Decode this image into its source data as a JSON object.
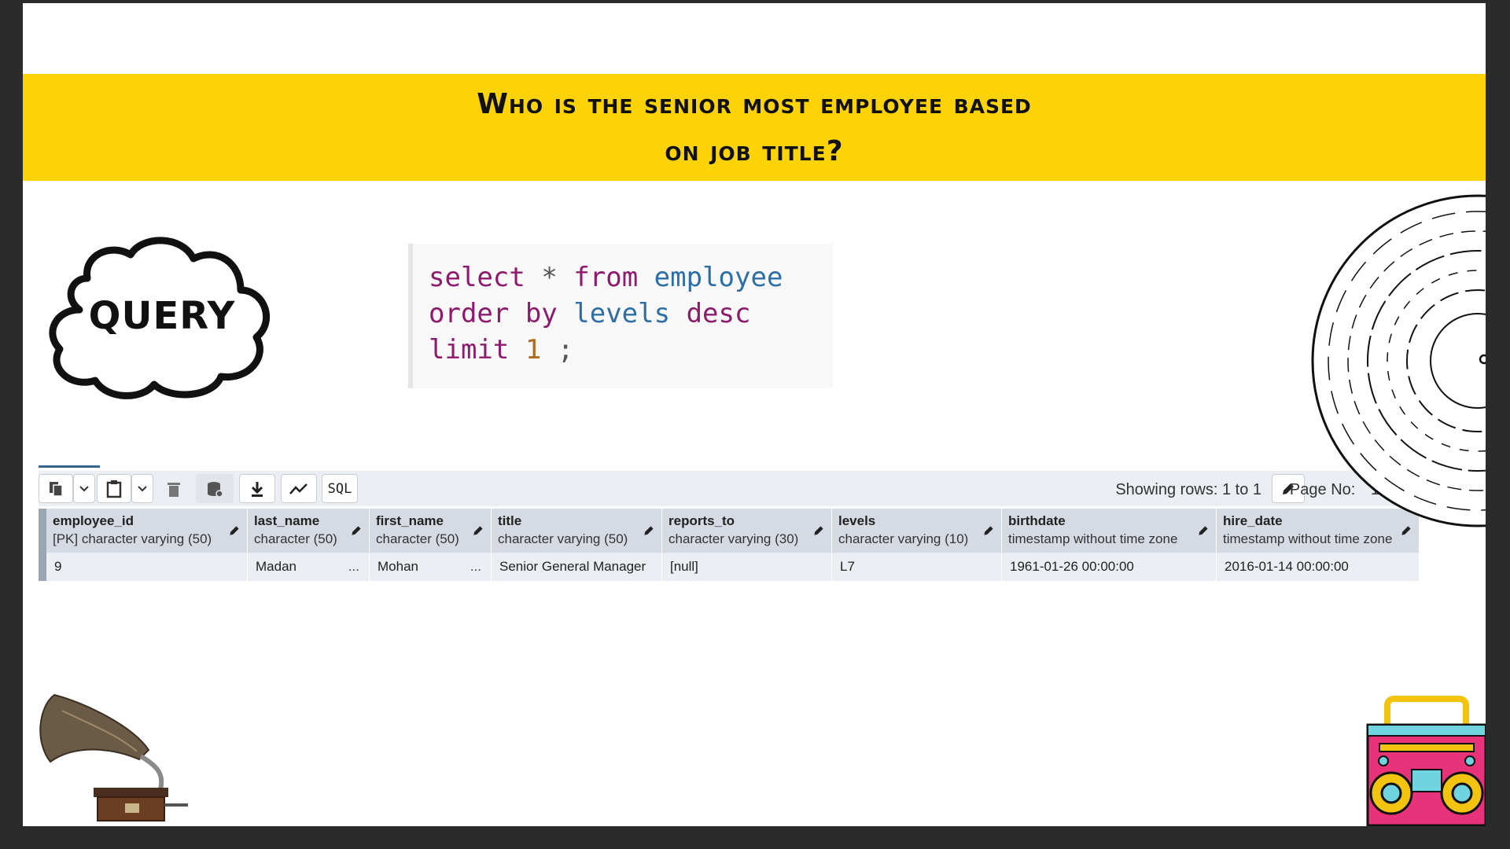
{
  "banner": {
    "line1": "Who is the senior most employee based",
    "line2": "on job title?"
  },
  "cloud_label": "QUERY",
  "code": {
    "line1": [
      "select",
      "*",
      "from",
      "employee"
    ],
    "line2": [
      "order by",
      "levels",
      "desc"
    ],
    "line3": [
      "limit",
      "1",
      ";"
    ]
  },
  "toolbar": {
    "sql_label": "SQL",
    "showing_rows": "Showing rows: 1 to 1",
    "page_no_label": "Page No:",
    "page_no_value": "1"
  },
  "table": {
    "columns": [
      {
        "name": "employee_id",
        "type": "[PK] character varying (50)"
      },
      {
        "name": "last_name",
        "type": "character (50)"
      },
      {
        "name": "first_name",
        "type": "character (50)"
      },
      {
        "name": "title",
        "type": "character varying (50)"
      },
      {
        "name": "reports_to",
        "type": "character varying (30)"
      },
      {
        "name": "levels",
        "type": "character varying (10)"
      },
      {
        "name": "birthdate",
        "type": "timestamp without time zone"
      },
      {
        "name": "hire_date",
        "type": "timestamp without time zone"
      }
    ],
    "rows": [
      [
        "9",
        "Madan",
        "Mohan",
        "Senior General Manager",
        "[null]",
        "L7",
        "1961-01-26 00:00:00",
        "2016-01-14 00:00:00"
      ]
    ],
    "ellipsis": "..."
  }
}
